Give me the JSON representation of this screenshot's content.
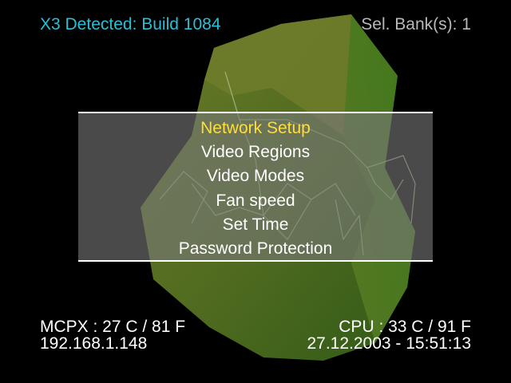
{
  "header": {
    "build": "X3 Detected: Build 1084",
    "bank": "Sel. Bank(s): 1"
  },
  "menu": {
    "selected_index": 0,
    "items": [
      "Network Setup",
      "Video Regions",
      "Video Modes",
      "Fan speed",
      "Set Time",
      "Password Protection"
    ]
  },
  "footer": {
    "mcpx_temp": "MCPX : 27 C / 81 F",
    "ip": "192.168.1.148",
    "cpu_temp": "CPU : 33 C / 91 F",
    "datetime": "27.12.2003 - 15:51:13"
  },
  "colors": {
    "background": "#000000",
    "header_build": "#29bfd7",
    "header_bank": "#b9b9b9",
    "menu_selected": "#ffdd3b",
    "menu_text": "#ffffff",
    "shape": "#5e6c1e"
  }
}
